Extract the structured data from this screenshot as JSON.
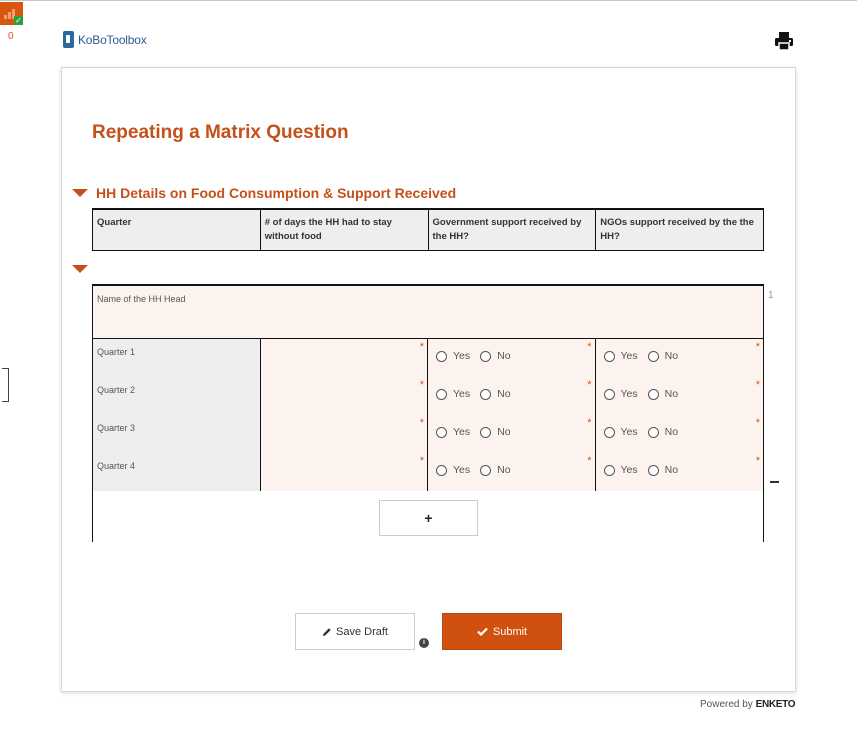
{
  "app": {
    "logo_text": "KoBoToolbox",
    "queue_count": "0"
  },
  "form": {
    "title": "Repeating a Matrix Question"
  },
  "group": {
    "label": "HH Details on Food Consumption & Support Received",
    "columns": [
      "Quarter",
      "# of days the HH had to stay without food",
      "Government support received by the HH?",
      "NGOs support received by the the HH?"
    ]
  },
  "repeat": {
    "number": "1",
    "name_label": "Name of the HH Head",
    "rows": [
      {
        "label": "Quarter 1"
      },
      {
        "label": "Quarter 2"
      },
      {
        "label": "Quarter 3"
      },
      {
        "label": "Quarter 4"
      }
    ],
    "required_mark": "*",
    "yes_label": "Yes",
    "no_label": "No",
    "add_label": "+"
  },
  "buttons": {
    "save_draft": "Save Draft",
    "submit": "Submit"
  },
  "footer": {
    "powered_by": "Powered by",
    "brand": "ENKETO"
  },
  "colors": {
    "accent": "#c4501a",
    "submit": "#d0510f",
    "field_bg": "#fdf3ee"
  },
  "icons": [
    "print-icon",
    "pencil-icon",
    "check-icon",
    "info-icon",
    "caret-down-icon"
  ]
}
